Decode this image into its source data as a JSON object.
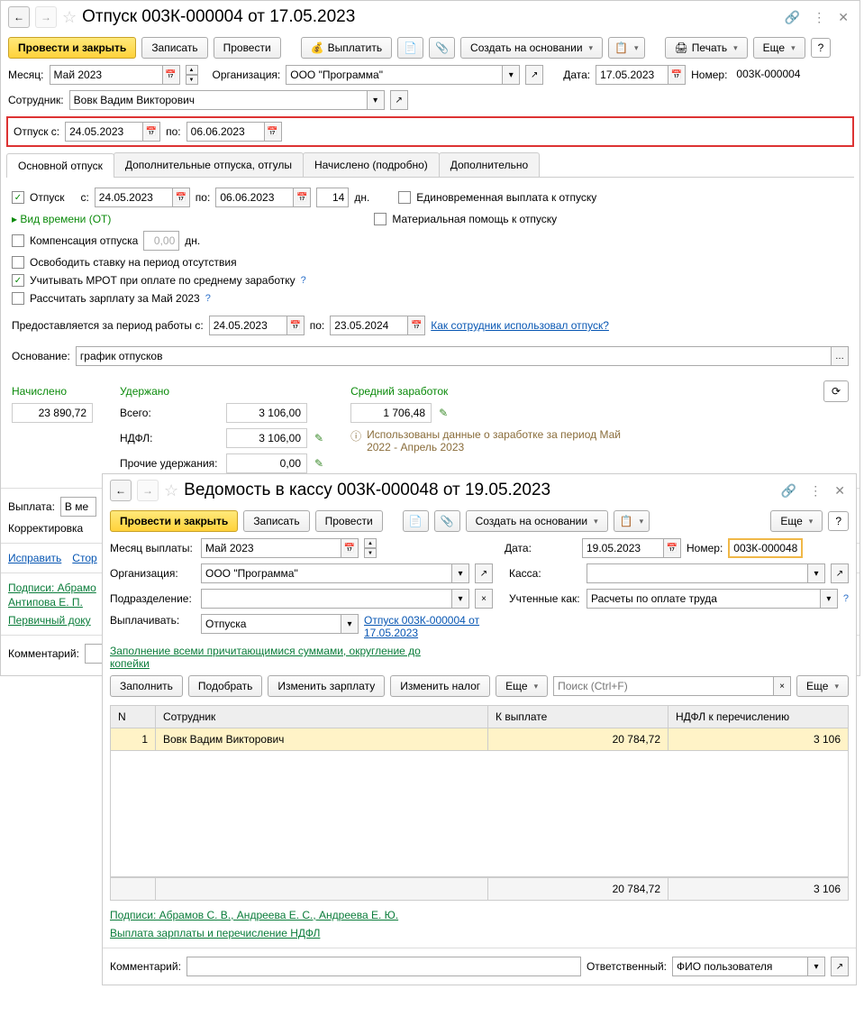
{
  "win1": {
    "title": "Отпуск 003К-000004 от 17.05.2023",
    "toolbar": {
      "post_close": "Провести и закрыть",
      "save": "Записать",
      "post": "Провести",
      "pay": "Выплатить",
      "create_based": "Создать на основании",
      "print": "Печать",
      "more": "Еще"
    },
    "month_lbl": "Месяц:",
    "month": "Май 2023",
    "org_lbl": "Организация:",
    "org": "ООО \"Программа\"",
    "date_lbl": "Дата:",
    "date": "17.05.2023",
    "num_lbl": "Номер:",
    "num": "003К-000004",
    "emp_lbl": "Сотрудник:",
    "emp": "Вовк Вадим Викторович",
    "leave_from_lbl": "Отпуск с:",
    "leave_from": "24.05.2023",
    "leave_to_lbl": "по:",
    "leave_to": "06.06.2023",
    "tabs": [
      "Основной отпуск",
      "Дополнительные отпуска, отгулы",
      "Начислено (подробно)",
      "Дополнительно"
    ],
    "main_leave": {
      "cb_leave": "Отпуск",
      "from_lbl": "с:",
      "from": "24.05.2023",
      "to_lbl": "по:",
      "to": "06.06.2023",
      "days": "14",
      "days_lbl": "дн.",
      "cb_lump": "Единовременная выплата к отпуску",
      "cb_mat": "Материальная помощь к отпуску",
      "time_type": "Вид времени (ОТ)",
      "cb_comp": "Компенсация отпуска",
      "comp_days": "0,00",
      "comp_days_lbl": "дн.",
      "cb_free": "Освободить ставку на период отсутствия",
      "cb_mrot": "Учитывать МРОТ при оплате по среднему заработку",
      "cb_recalc": "Рассчитать зарплату за Май 2023",
      "period_lbl": "Предоставляется за период работы с:",
      "period_from": "24.05.2023",
      "period_to_lbl": "по:",
      "period_to": "23.05.2024",
      "usage_link": "Как сотрудник использовал отпуск?",
      "reason_lbl": "Основание:",
      "reason": "график отпусков"
    },
    "calc": {
      "accr_lbl": "Начислено",
      "accr": "23 890,72",
      "withheld_lbl": "Удержано",
      "total_lbl": "Всего:",
      "total": "3 106,00",
      "ndfl_lbl": "НДФЛ:",
      "ndfl": "3 106,00",
      "other_lbl": "Прочие удержания:",
      "other": "0,00",
      "avg_lbl": "Средний заработок",
      "avg": "1 706,48",
      "info": "Использованы данные о заработке за период Май 2022 - Апрель 2023"
    },
    "payout_lbl": "Выплата:",
    "payout": "В ме",
    "correction_lbl": "Корректировка",
    "fix_link": "Исправить",
    "cancel_link": "Стор",
    "sign_link": "Подписи: Абрамо",
    "antipova": "Антипова Е. П.",
    "primary_doc": "Первичный доку",
    "comment_lbl": "Комментарий:"
  },
  "win2": {
    "title": "Ведомость в кассу 003К-000048 от 19.05.2023",
    "toolbar": {
      "post_close": "Провести и закрыть",
      "save": "Записать",
      "post": "Провести",
      "create_based": "Создать на основании",
      "more": "Еще"
    },
    "month_lbl": "Месяц выплаты:",
    "month": "Май 2023",
    "date_lbl": "Дата:",
    "date": "19.05.2023",
    "num_lbl": "Номер:",
    "num": "003К-000048",
    "org_lbl": "Организация:",
    "org": "ООО \"Программа\"",
    "kassa_lbl": "Касса:",
    "dep_lbl": "Подразделение:",
    "acct_lbl": "Учтенные как:",
    "acct": "Расчеты по оплате труда",
    "pay_lbl": "Выплачивать:",
    "pay": "Отпуска",
    "doc_link": "Отпуск 003К-000004 от 17.05.2023",
    "fill_link": "Заполнение всеми причитающимися суммами, округление до копейки",
    "btns": {
      "fill": "Заполнить",
      "pick": "Подобрать",
      "chg_salary": "Изменить зарплату",
      "chg_tax": "Изменить налог",
      "more": "Еще",
      "more2": "Еще"
    },
    "search_ph": "Поиск (Ctrl+F)",
    "cols": [
      "N",
      "Сотрудник",
      "К выплате",
      "НДФЛ к перечислению"
    ],
    "row": {
      "n": "1",
      "emp": "Вовк Вадим Викторович",
      "sum": "20 784,72",
      "ndfl": "3 106"
    },
    "foot": {
      "sum": "20 784,72",
      "ndfl": "3 106"
    },
    "sign_link": "Подписи: Абрамов С. В., Андреева Е. С., Андреева Е. Ю.",
    "pay_link": "Выплата зарплаты и перечисление НДФЛ",
    "comment_lbl": "Комментарий:",
    "resp_lbl": "Ответственный:",
    "resp": "ФИО пользователя"
  }
}
